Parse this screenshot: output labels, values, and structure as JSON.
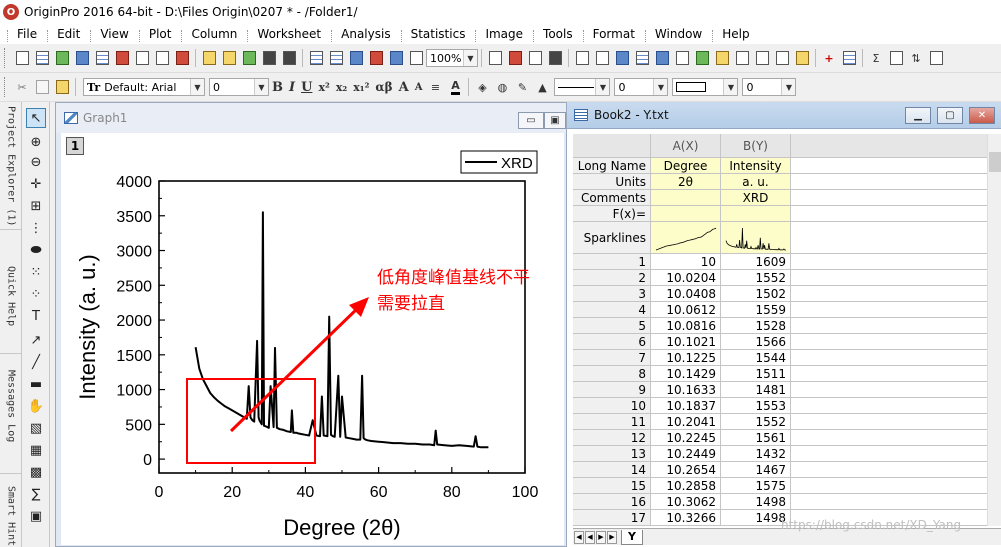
{
  "app": {
    "title": "OriginPro 2016 64-bit - D:\\Files Origin\\0207 * - /Folder1/",
    "icon": "originpro-app-icon"
  },
  "menu": [
    "File",
    "Edit",
    "View",
    "Plot",
    "Column",
    "Worksheet",
    "Analysis",
    "Statistics",
    "Image",
    "Tools",
    "Format",
    "Window",
    "Help"
  ],
  "toolbar": {
    "zoom": "100%",
    "font_name": "Default: Arial",
    "font_size": "0",
    "symbols": {
      "bold": "B",
      "italic": "I",
      "underline": "U",
      "superscript": "x²",
      "subscript": "x₂",
      "supersub": "x₁²",
      "greek": "αβ",
      "increase_font": "A",
      "decrease_font": "A"
    },
    "line_size": "0",
    "line_width": "0"
  },
  "dock_tabs": [
    "Project Explorer (1)",
    "Quick Help",
    "Messages Log",
    "Smart Hint"
  ],
  "graph_window": {
    "title": "Graph1",
    "layer": "1",
    "legend": "XRD",
    "annotation": {
      "line1": "低角度峰值基线不平",
      "line2": "需要拉直",
      "color": "#ff0000"
    }
  },
  "chart_data": {
    "type": "line",
    "xlabel": "Degree (2θ)",
    "ylabel": "Intensity (a. u.)",
    "xlim": [
      0,
      100
    ],
    "ylim": [
      -200,
      4000
    ],
    "xticks": [
      0,
      20,
      40,
      60,
      80,
      100
    ],
    "yticks": [
      0,
      500,
      1000,
      1500,
      2000,
      2500,
      3000,
      3500,
      4000
    ],
    "grid": false,
    "legend_position": "top-right",
    "series": [
      {
        "name": "XRD",
        "color": "#000000",
        "x": [
          10,
          11,
          12,
          13,
          14,
          15,
          16,
          17,
          18,
          19,
          20,
          21,
          22,
          23,
          24,
          24.5,
          25,
          25.5,
          26,
          26.8,
          27.2,
          27.5,
          28.1,
          28.4,
          28.7,
          29.2,
          30,
          30.5,
          31.3,
          31.7,
          32.2,
          33,
          34,
          35,
          36,
          36.3,
          36.7,
          37.5,
          38,
          39,
          40,
          41,
          42,
          43,
          44,
          44.5,
          45,
          46,
          46.5,
          47,
          47.5,
          48,
          49,
          49.5,
          50,
          51,
          52,
          53,
          54,
          55,
          55.5,
          55.9,
          56.4,
          57,
          58,
          60,
          62,
          64,
          66,
          68,
          70,
          72,
          74,
          75.2,
          75.6,
          76,
          78,
          80,
          82,
          84,
          86,
          86.5,
          87,
          88,
          90
        ],
        "y": [
          1609,
          1300,
          1150,
          1050,
          950,
          890,
          840,
          800,
          760,
          730,
          700,
          670,
          640,
          610,
          580,
          1050,
          600,
          560,
          540,
          1700,
          600,
          550,
          500,
          3550,
          480,
          470,
          450,
          1050,
          460,
          1600,
          450,
          430,
          420,
          400,
          390,
          700,
          380,
          380,
          370,
          360,
          350,
          340,
          560,
          340,
          330,
          900,
          340,
          330,
          2050,
          350,
          330,
          320,
          1200,
          320,
          900,
          310,
          300,
          290,
          280,
          280,
          1200,
          300,
          280,
          270,
          260,
          250,
          240,
          230,
          230,
          220,
          220,
          210,
          210,
          200,
          410,
          210,
          200,
          190,
          200,
          190,
          180,
          330,
          180,
          170,
          170
        ]
      }
    ]
  },
  "book_window": {
    "title": "Book2 - Y.txt",
    "columns": [
      "A(X)",
      "B(Y)"
    ],
    "meta_rows": [
      {
        "label": "Long Name",
        "a": "Degree",
        "b": "Intensity"
      },
      {
        "label": "Units",
        "a": "2θ",
        "b": "a. u."
      },
      {
        "label": "Comments",
        "a": "",
        "b": "XRD"
      },
      {
        "label": "F(x)=",
        "a": "",
        "b": ""
      },
      {
        "label": "Sparklines",
        "a": "",
        "b": ""
      }
    ],
    "rows": [
      {
        "n": "1",
        "a": "10",
        "b": "1609"
      },
      {
        "n": "2",
        "a": "10.0204",
        "b": "1552"
      },
      {
        "n": "3",
        "a": "10.0408",
        "b": "1502"
      },
      {
        "n": "4",
        "a": "10.0612",
        "b": "1559"
      },
      {
        "n": "5",
        "a": "10.0816",
        "b": "1528"
      },
      {
        "n": "6",
        "a": "10.1021",
        "b": "1566"
      },
      {
        "n": "7",
        "a": "10.1225",
        "b": "1544"
      },
      {
        "n": "8",
        "a": "10.1429",
        "b": "1511"
      },
      {
        "n": "9",
        "a": "10.1633",
        "b": "1481"
      },
      {
        "n": "10",
        "a": "10.1837",
        "b": "1553"
      },
      {
        "n": "11",
        "a": "10.2041",
        "b": "1552"
      },
      {
        "n": "12",
        "a": "10.2245",
        "b": "1561"
      },
      {
        "n": "13",
        "a": "10.2449",
        "b": "1432"
      },
      {
        "n": "14",
        "a": "10.2654",
        "b": "1467"
      },
      {
        "n": "15",
        "a": "10.2858",
        "b": "1575"
      },
      {
        "n": "16",
        "a": "10.3062",
        "b": "1498"
      },
      {
        "n": "17",
        "a": "10.3266",
        "b": "1498"
      }
    ],
    "sheet_tab": "Y"
  },
  "watermark": "https://blog.csdn.net/XD_Yang"
}
